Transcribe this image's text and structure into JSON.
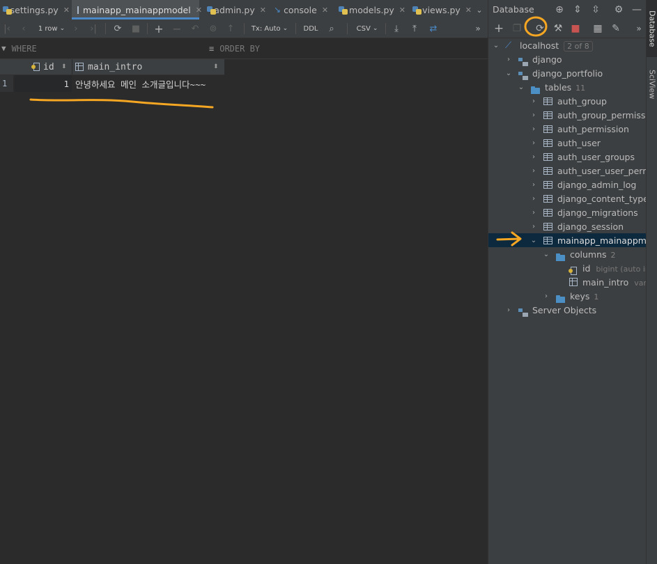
{
  "tabs": [
    {
      "label": "settings.py",
      "icon": "python-file-icon",
      "active": false
    },
    {
      "label": "mainapp_mainappmodel",
      "icon": "table-icon",
      "active": true
    },
    {
      "label": "admin.py",
      "icon": "python-file-icon",
      "active": false
    },
    {
      "label": "console",
      "icon": "console-icon",
      "active": false
    },
    {
      "label": "models.py",
      "icon": "python-file-icon",
      "active": false
    },
    {
      "label": "views.py",
      "icon": "python-file-icon",
      "active": false
    }
  ],
  "result_toolbar": {
    "rows_label": "1 row",
    "tx_label": "Tx: Auto",
    "ddl_label": "DDL",
    "format_label": "CSV"
  },
  "filter": {
    "where_label": "WHERE",
    "order_label": "ORDER BY"
  },
  "grid": {
    "columns": [
      "id",
      "main_intro"
    ],
    "rows": [
      {
        "rownum": "1",
        "id": "1",
        "main_intro": "안녕하세요 메인 소개글입니다~~~"
      }
    ]
  },
  "db_panel": {
    "title": "Database",
    "tree": {
      "root": {
        "label": "localhost",
        "badge": "2 of 8"
      },
      "schemas": [
        {
          "label": "django"
        },
        {
          "label": "django_portfolio"
        }
      ],
      "tables_folder": {
        "label": "tables",
        "count": "11"
      },
      "tables": [
        "auth_group",
        "auth_group_permissions",
        "auth_permission",
        "auth_user",
        "auth_user_groups",
        "auth_user_user_permissi",
        "django_admin_log",
        "django_content_type",
        "django_migrations",
        "django_session",
        "mainapp_mainappmode"
      ],
      "columns_folder": {
        "label": "columns",
        "count": "2"
      },
      "columns": [
        {
          "name": "id",
          "type": "bigint (auto in"
        },
        {
          "name": "main_intro",
          "type": "varch"
        }
      ],
      "keys_folder": {
        "label": "keys",
        "count": "1"
      },
      "server_objects": {
        "label": "Server Objects"
      }
    }
  },
  "side_tabs": [
    "Database",
    "SciView"
  ],
  "colors": {
    "annotation": "#f5a623",
    "selection": "#0d293e",
    "accent": "#4a88c7"
  }
}
